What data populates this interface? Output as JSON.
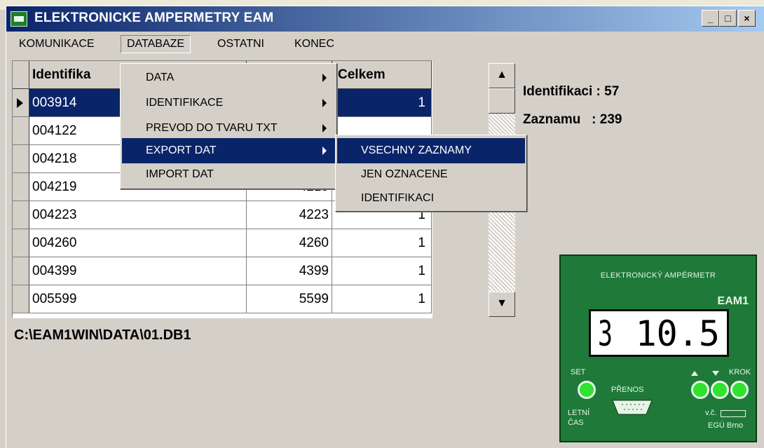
{
  "window": {
    "title": "ELEKTRONICKE AMPERMETRY EAM",
    "minimize": "_",
    "maximize": "□",
    "close": "×"
  },
  "menubar": [
    "KOMUNIKACE",
    "DATABAZE",
    "OSTATNI",
    "KONEC"
  ],
  "grid": {
    "columns": [
      "Identifika",
      "",
      "Celkem"
    ],
    "rows": [
      {
        "id": "003914",
        "num": "",
        "total": "1"
      },
      {
        "id": "004122",
        "num": "",
        "total": ""
      },
      {
        "id": "004218",
        "num": "",
        "total": ""
      },
      {
        "id": "004219",
        "num": "4219",
        "total": ""
      },
      {
        "id": "004223",
        "num": "4223",
        "total": "1"
      },
      {
        "id": "004260",
        "num": "4260",
        "total": "1"
      },
      {
        "id": "004399",
        "num": "4399",
        "total": "1"
      },
      {
        "id": "005599",
        "num": "5599",
        "total": "1"
      }
    ]
  },
  "stats": {
    "identifikaci": "Identifikaci : 57",
    "zaznamu": "Zaznamu   : 239"
  },
  "path": "C:\\EAM1WIN\\DATA\\01.DB1",
  "databaze_menu": [
    "DATA",
    "IDENTIFIKACE",
    "PREVOD DO TVARU TXT",
    "EXPORT DAT",
    "IMPORT DAT"
  ],
  "export_submenu": [
    "VSECHNY ZAZNAMY",
    "JEN OZNACENE",
    "IDENTIFIKACI"
  ],
  "device": {
    "title": "ELEKTRONICKÝ AMPÉRMETR",
    "model": "EAM1",
    "display_left": "3",
    "display_right": "10.5",
    "label_set": "SET",
    "label_krok": "KROK",
    "label_prenos": "PŘENOS",
    "label_letni": "LETNÍ",
    "label_cas": "ČAS",
    "label_vc": "v.č.",
    "label_egu": "EGÚ Brno"
  },
  "colors": {
    "title_start": "#0a246a",
    "title_end": "#a6caf0",
    "selection": "#0a246a",
    "device_green": "#1f7a3a",
    "led_green": "#2fe32f"
  }
}
